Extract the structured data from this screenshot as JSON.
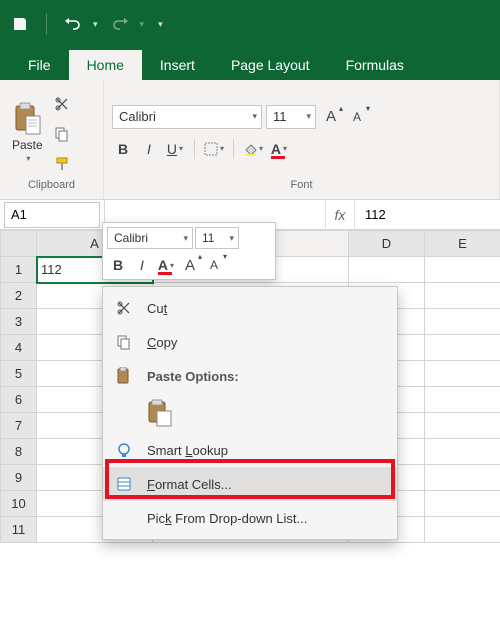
{
  "qat": {
    "undo": "↶",
    "redo": "↷"
  },
  "tabs": {
    "file": "File",
    "home": "Home",
    "insert": "Insert",
    "pagelayout": "Page Layout",
    "formulas": "Formulas"
  },
  "ribbon": {
    "clipboard": {
      "paste": "Paste",
      "label": "Clipboard"
    },
    "font": {
      "name": "Calibri",
      "size": "11",
      "bold": "B",
      "italic": "I",
      "underline": "U",
      "label": "Font"
    }
  },
  "fbar": {
    "name": "A1",
    "fx": "fx",
    "value": "112"
  },
  "columns": [
    "A",
    "D",
    "E"
  ],
  "rows": [
    "1",
    "2",
    "3",
    "4",
    "5",
    "6",
    "7",
    "8",
    "9",
    "10",
    "11"
  ],
  "cellA1": "112",
  "minitb": {
    "font": "Calibri",
    "size": "11",
    "bold": "B",
    "italic": "I",
    "grow": "A",
    "shrink": "A"
  },
  "ctx": {
    "cut": "Cut",
    "copy": "Copy",
    "pasteopts": "Paste Options:",
    "smart": "Smart Lookup",
    "format": "Format Cells...",
    "pick": "Pick From Drop-down List..."
  }
}
